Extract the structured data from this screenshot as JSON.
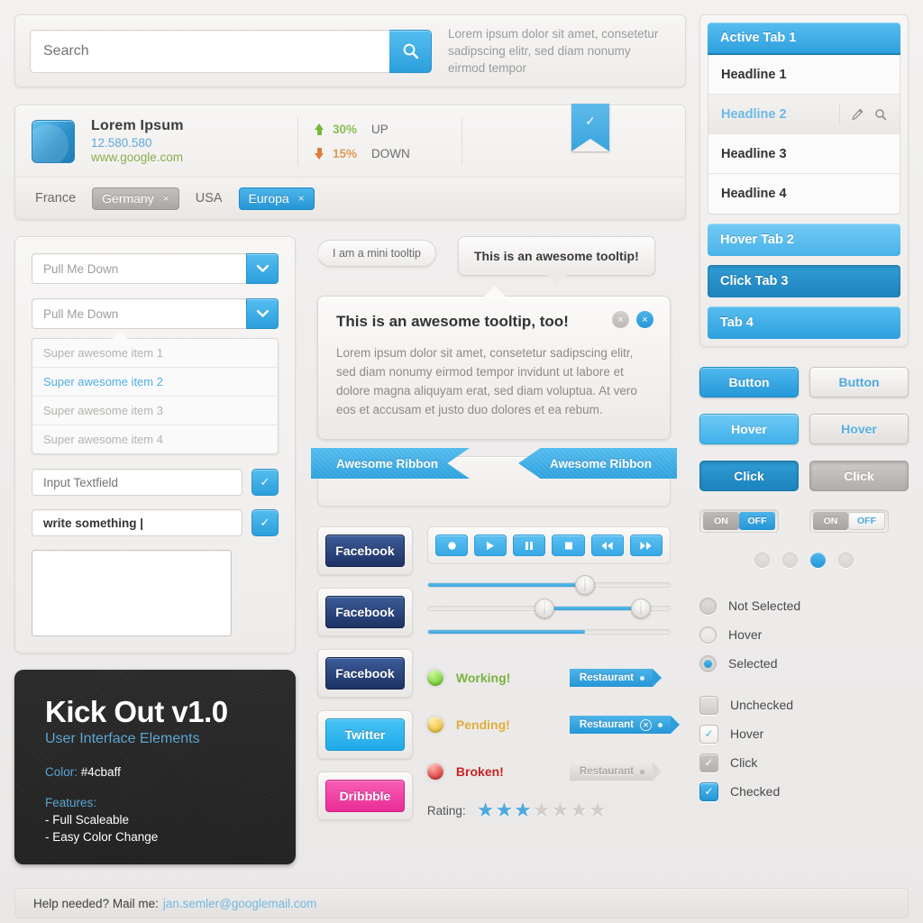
{
  "search": {
    "placeholder": "Search",
    "value": "",
    "button_icon": "search-icon",
    "side_text": "Lorem ipsum dolor sit amet, consetetur sadipscing elitr, sed diam nonumy eirmod tempor"
  },
  "result_card": {
    "title": "Lorem Ipsum",
    "number": "12.580.580",
    "url": "www.google.com",
    "stats": [
      {
        "direction": "up",
        "percent": "30%",
        "label": "UP"
      },
      {
        "direction": "down",
        "percent": "15%",
        "label": "DOWN"
      }
    ],
    "bookmark_icon": "checkmark-bookmark-icon",
    "tags": [
      {
        "label": "France",
        "style": "plain",
        "closable": false
      },
      {
        "label": "Germany",
        "style": "grey",
        "closable": true
      },
      {
        "label": "USA",
        "style": "plain",
        "closable": false
      },
      {
        "label": "Europa",
        "style": "blue",
        "closable": true
      }
    ],
    "close_glyph": "×"
  },
  "form": {
    "select_1": {
      "value": "Pull Me Down",
      "caret_icon": "chevron-down-icon"
    },
    "select_2": {
      "value": "Pull Me Down",
      "caret_icon": "chevron-down-icon"
    },
    "dropdown_items": [
      {
        "label": "Super awesome item 1",
        "active": false
      },
      {
        "label": "Super awesome item 2",
        "active": true
      },
      {
        "label": "Super awesome item 3",
        "active": false
      },
      {
        "label": "Super awesome item 4",
        "active": false
      }
    ],
    "input_empty": {
      "placeholder": "Input Textfield",
      "value": ""
    },
    "input_filled": {
      "value": "write something |"
    },
    "submit_icon": "checkmark-icon",
    "textarea_value": ""
  },
  "promo": {
    "title": "Kick Out v1.0",
    "subtitle": "User Interface Elements",
    "color_label": "Color:",
    "color_value": "#4cbaff",
    "features_label": "Features:",
    "features": [
      "- Full Scaleable",
      "- Easy Color Change"
    ]
  },
  "tooltips": {
    "mini": "I am a mini tooltip",
    "small": "This is an awesome tooltip!",
    "card_title": "This is an awesome tooltip, too!",
    "card_body": "Lorem ipsum dolor sit amet, consetetur sadipscing elitr, sed diam nonumy eirmod tempor invidunt ut labore et dolore magna aliquyam erat, sed diam voluptua. At vero eos et accusam et justo duo dolores et ea rebum.",
    "close_glyph": "×"
  },
  "ribbons": {
    "left": "Awesome Ribbon",
    "right": "Awesome Ribbon"
  },
  "social_buttons": [
    {
      "label": "Facebook",
      "style": "fb"
    },
    {
      "label": "Facebook",
      "style": "fb"
    },
    {
      "label": "Facebook",
      "style": "fb"
    },
    {
      "label": "Twitter",
      "style": "tw"
    },
    {
      "label": "Dribbble",
      "style": "dr"
    }
  ],
  "media_buttons": [
    {
      "name": "record-icon"
    },
    {
      "name": "play-icon"
    },
    {
      "name": "pause-icon"
    },
    {
      "name": "stop-icon"
    },
    {
      "name": "rewind-icon"
    },
    {
      "name": "fast-forward-icon"
    }
  ],
  "sliders": [
    {
      "type": "single",
      "value": 65
    },
    {
      "type": "range",
      "from": 48,
      "to": 88
    },
    {
      "type": "progress",
      "value": 65
    }
  ],
  "statuses": [
    {
      "label": "Working!",
      "color": "green"
    },
    {
      "label": "Pending!",
      "color": "yellow"
    },
    {
      "label": "Broken!",
      "color": "red"
    }
  ],
  "price_tags": [
    {
      "label": "Restaurant",
      "state": "on",
      "has_close": false
    },
    {
      "label": "Restaurant",
      "state": "on",
      "has_close": true
    },
    {
      "label": "Restaurant",
      "state": "off",
      "has_close": false
    }
  ],
  "rating": {
    "label": "Rating:",
    "value": 3,
    "max": 7,
    "star_glyph": "★"
  },
  "tabs": {
    "active": "Active Tab 1",
    "headlines": [
      {
        "label": "Headline 1",
        "selected": false
      },
      {
        "label": "Headline 2",
        "selected": true
      },
      {
        "label": "Headline 3",
        "selected": false
      },
      {
        "label": "Headline 4",
        "selected": false
      }
    ],
    "row_icons": [
      {
        "name": "pencil-icon"
      },
      {
        "name": "search-icon"
      }
    ],
    "others": [
      {
        "label": "Hover Tab 2",
        "state": "hover"
      },
      {
        "label": "Click Tab 3",
        "state": "click"
      },
      {
        "label": "Tab 4",
        "state": "plain"
      }
    ]
  },
  "buttons": [
    {
      "label": "Button",
      "style": "b1"
    },
    {
      "label": "Button",
      "style": "g1"
    },
    {
      "label": "Hover",
      "style": "b2"
    },
    {
      "label": "Hover",
      "style": "g2"
    },
    {
      "label": "Click",
      "style": "b3"
    },
    {
      "label": "Click",
      "style": "g3"
    }
  ],
  "toggles": [
    {
      "on_label": "ON",
      "off_label": "OFF",
      "variant": "blue"
    },
    {
      "on_label": "ON",
      "off_label": "OFF",
      "variant": "white"
    }
  ],
  "pager_dots": {
    "count": 4,
    "active_index": 2
  },
  "radios": [
    {
      "label": "Not Selected",
      "state": "off"
    },
    {
      "label": "Hover",
      "state": "hover"
    },
    {
      "label": "Selected",
      "state": "on"
    }
  ],
  "checkboxes": [
    {
      "label": "Unchecked",
      "state": "unchecked"
    },
    {
      "label": "Hover",
      "state": "hover"
    },
    {
      "label": "Click",
      "state": "click"
    },
    {
      "label": "Checked",
      "state": "checked"
    }
  ],
  "footer": {
    "text": "Help needed? Mail me:",
    "email": "jan.semler@googlemail.com"
  },
  "colors": {
    "accent": "#4cbaff",
    "accent_dark": "#2596d6",
    "green": "#8bbd52",
    "orange": "#e09a5a",
    "pink": "#ea2b96"
  }
}
